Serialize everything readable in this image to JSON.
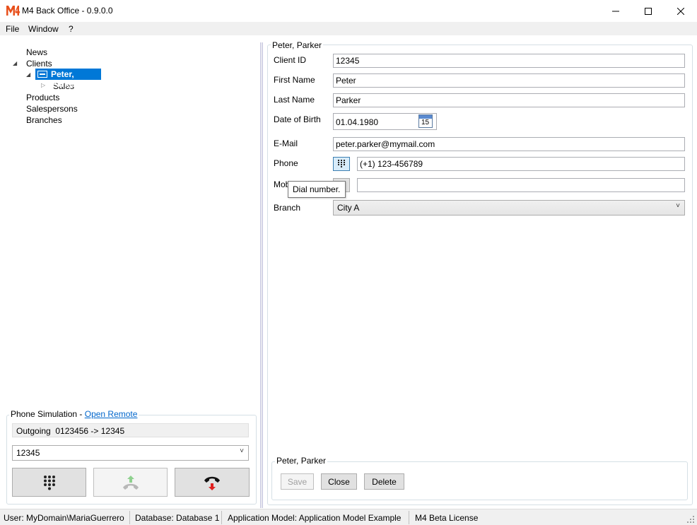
{
  "window": {
    "title": "M4 Back Office - 0.9.0.0",
    "logo": "M4"
  },
  "menu": {
    "items": [
      "File",
      "Window",
      "?"
    ]
  },
  "tree": {
    "news": "News",
    "clients": "Clients",
    "selected_client": "Peter, Parker",
    "sales": "Sales",
    "products": "Products",
    "salespersons": "Salespersons",
    "branches": "Branches"
  },
  "phone_sim": {
    "title": "Phone Simulation - ",
    "link": "Open Remote",
    "status": "Outgoing  0123456 -> 12345",
    "number": "12345"
  },
  "detail": {
    "group_title": "Peter, Parker",
    "client_id_label": "Client ID",
    "client_id": "12345",
    "first_name_label": "First Name",
    "first_name": "Peter",
    "last_name_label": "Last Name",
    "last_name": "Parker",
    "dob_label": "Date of Birth",
    "dob": "01.04.1980",
    "calendar_day": "15",
    "email_label": "E-Mail",
    "email": "peter.parker@mymail.com",
    "phone_label": "Phone",
    "phone": "(+1) 123-456789",
    "mobile_label": "Mobile",
    "mobile": "",
    "branch_label": "Branch",
    "branch": "City A",
    "tooltip": "Dial number."
  },
  "actions": {
    "group_title": "Peter, Parker",
    "save": "Save",
    "close": "Close",
    "delete": "Delete"
  },
  "status": {
    "user": "User: MyDomain\\MariaGuerrero",
    "database": "Database: Database 1",
    "app_model": "Application Model: Application Model Example",
    "license": "M4 Beta License"
  },
  "colors": {
    "accent": "#0078d7",
    "logo": "#e8501c",
    "hangup": "#e02020",
    "pickup": "#8fd18f"
  }
}
